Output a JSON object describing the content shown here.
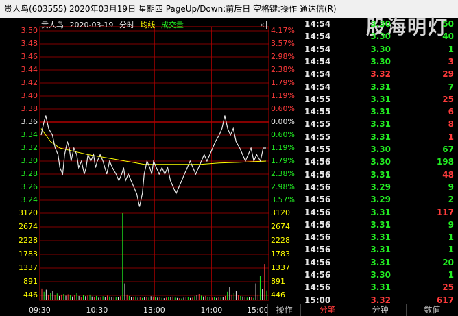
{
  "window": {
    "title": "贵人鸟(603555)  2020年03月19日 星期四  PageUp/Down:前后日  空格键:操作  通达信(R)",
    "watermark": "股海明灯"
  },
  "chart_header": {
    "name": "贵人鸟",
    "date": "2020-03-19",
    "mode": "分时",
    "legend_avg": "均线",
    "legend_vol": "成交量",
    "close_glyph": "×"
  },
  "colors": {
    "bg": "#000000",
    "grid": "#b00000",
    "price": "#e8e8e8",
    "avg": "#ffff00",
    "up": "#ff3b3b",
    "down": "#22ee22",
    "flat": "#e8e8e8"
  },
  "price_axis": {
    "left_labels": [
      "3.50",
      "3.48",
      "3.46",
      "3.44",
      "3.42",
      "3.40",
      "3.38",
      "3.36",
      "3.34",
      "3.32",
      "3.30",
      "3.28",
      "3.26",
      "3.24"
    ],
    "right_labels": [
      "4.17%",
      "3.57%",
      "2.98%",
      "2.38%",
      "1.79%",
      "1.19%",
      "0.60%",
      "0.00%",
      "0.60%",
      "1.19%",
      "1.79%",
      "2.38%",
      "2.98%",
      "3.57%"
    ]
  },
  "volume_axis": {
    "labels": [
      "3120",
      "2674",
      "2228",
      "1783",
      "1337",
      "891",
      "446"
    ]
  },
  "time_axis": {
    "labels": [
      "09:30",
      "10:30",
      "13:00",
      "14:00",
      "15:00"
    ],
    "corner": "操作"
  },
  "chart_data": {
    "type": "line",
    "prev_close": 3.36,
    "ylim": [
      3.23,
      3.51
    ],
    "x_range": [
      0,
      240
    ],
    "series": [
      {
        "points": [
          [
            0,
            3.34
          ],
          [
            3,
            3.36
          ],
          [
            5,
            3.37
          ],
          [
            8,
            3.35
          ],
          [
            12,
            3.34
          ],
          [
            15,
            3.32
          ],
          [
            18,
            3.31
          ],
          [
            20,
            3.29
          ],
          [
            23,
            3.28
          ],
          [
            25,
            3.31
          ],
          [
            28,
            3.33
          ],
          [
            30,
            3.32
          ],
          [
            32,
            3.3
          ],
          [
            35,
            3.32
          ],
          [
            38,
            3.31
          ],
          [
            40,
            3.29
          ],
          [
            43,
            3.3
          ],
          [
            46,
            3.28
          ],
          [
            48,
            3.29
          ],
          [
            50,
            3.31
          ],
          [
            53,
            3.3
          ],
          [
            56,
            3.31
          ],
          [
            58,
            3.29
          ],
          [
            60,
            3.3
          ],
          [
            63,
            3.31
          ],
          [
            66,
            3.3
          ],
          [
            68,
            3.29
          ],
          [
            70,
            3.28
          ],
          [
            73,
            3.3
          ],
          [
            76,
            3.29
          ],
          [
            80,
            3.28
          ],
          [
            83,
            3.27
          ],
          [
            86,
            3.28
          ],
          [
            88,
            3.29
          ],
          [
            90,
            3.27
          ],
          [
            93,
            3.28
          ],
          [
            96,
            3.27
          ],
          [
            99,
            3.26
          ],
          [
            102,
            3.25
          ],
          [
            105,
            3.23
          ],
          [
            108,
            3.25
          ],
          [
            110,
            3.28
          ],
          [
            113,
            3.3
          ],
          [
            116,
            3.29
          ],
          [
            118,
            3.28
          ],
          [
            120,
            3.3
          ],
          [
            123,
            3.29
          ],
          [
            126,
            3.28
          ],
          [
            129,
            3.29
          ],
          [
            132,
            3.28
          ],
          [
            135,
            3.29
          ],
          [
            138,
            3.27
          ],
          [
            141,
            3.26
          ],
          [
            144,
            3.25
          ],
          [
            147,
            3.26
          ],
          [
            150,
            3.27
          ],
          [
            153,
            3.28
          ],
          [
            156,
            3.29
          ],
          [
            159,
            3.3
          ],
          [
            162,
            3.29
          ],
          [
            165,
            3.28
          ],
          [
            168,
            3.29
          ],
          [
            171,
            3.3
          ],
          [
            174,
            3.31
          ],
          [
            177,
            3.3
          ],
          [
            180,
            3.31
          ],
          [
            183,
            3.32
          ],
          [
            186,
            3.33
          ],
          [
            190,
            3.34
          ],
          [
            193,
            3.35
          ],
          [
            196,
            3.37
          ],
          [
            199,
            3.35
          ],
          [
            202,
            3.34
          ],
          [
            205,
            3.35
          ],
          [
            208,
            3.33
          ],
          [
            212,
            3.32
          ],
          [
            215,
            3.31
          ],
          [
            218,
            3.3
          ],
          [
            221,
            3.31
          ],
          [
            224,
            3.32
          ],
          [
            227,
            3.3
          ],
          [
            230,
            3.31
          ],
          [
            234,
            3.3
          ],
          [
            237,
            3.32
          ],
          [
            240,
            3.32
          ]
        ]
      },
      {
        "points": [
          [
            0,
            3.35
          ],
          [
            5,
            3.34
          ],
          [
            10,
            3.33
          ],
          [
            20,
            3.32
          ],
          [
            35,
            3.315
          ],
          [
            50,
            3.31
          ],
          [
            70,
            3.305
          ],
          [
            90,
            3.3
          ],
          [
            110,
            3.295
          ],
          [
            130,
            3.295
          ],
          [
            150,
            3.295
          ],
          [
            170,
            3.295
          ],
          [
            190,
            3.297
          ],
          [
            210,
            3.298
          ],
          [
            240,
            3.3
          ]
        ]
      }
    ],
    "volume": [
      420,
      300,
      380,
      200,
      260,
      330,
      180,
      240,
      150,
      200,
      220,
      160,
      210,
      190,
      130,
      170,
      260,
      150,
      120,
      180,
      140,
      160,
      200,
      130,
      110,
      150,
      90,
      120,
      140,
      100,
      160,
      130,
      110,
      90,
      120,
      100,
      140,
      3120,
      600,
      200,
      150,
      120,
      100,
      130,
      90,
      110,
      80,
      100,
      120,
      90,
      140,
      130,
      110,
      90,
      100,
      80,
      70,
      90,
      110,
      100,
      130,
      90,
      80,
      70,
      60,
      90,
      120,
      100,
      80,
      90,
      140,
      180,
      220,
      160,
      130,
      150,
      120,
      100,
      90,
      110,
      80,
      100,
      90,
      120,
      150,
      300,
      480,
      200,
      260,
      320,
      180,
      150,
      130,
      110,
      90,
      100,
      120,
      80,
      600,
      200,
      880,
      400,
      1300,
      350
    ]
  },
  "ticks": [
    {
      "time": "14:54",
      "price": "3.30",
      "vol": "50",
      "dir": "down"
    },
    {
      "time": "14:54",
      "price": "3.30",
      "vol": "40",
      "dir": "down"
    },
    {
      "time": "14:54",
      "price": "3.30",
      "vol": "1",
      "dir": "down"
    },
    {
      "time": "14:54",
      "price": "3.30",
      "vol": "3",
      "dir": "up"
    },
    {
      "time": "14:54",
      "price": "3.32",
      "vol": "29",
      "dir": "up"
    },
    {
      "time": "14:54",
      "price": "3.31",
      "vol": "7",
      "dir": "down"
    },
    {
      "time": "14:55",
      "price": "3.31",
      "vol": "25",
      "dir": "up"
    },
    {
      "time": "14:55",
      "price": "3.31",
      "vol": "6",
      "dir": "up"
    },
    {
      "time": "14:55",
      "price": "3.31",
      "vol": "8",
      "dir": "up"
    },
    {
      "time": "14:55",
      "price": "3.31",
      "vol": "1",
      "dir": "up"
    },
    {
      "time": "14:55",
      "price": "3.30",
      "vol": "67",
      "dir": "down"
    },
    {
      "time": "14:56",
      "price": "3.30",
      "vol": "198",
      "dir": "down"
    },
    {
      "time": "14:56",
      "price": "3.31",
      "vol": "48",
      "dir": "up"
    },
    {
      "time": "14:56",
      "price": "3.29",
      "vol": "9",
      "dir": "down"
    },
    {
      "time": "14:56",
      "price": "3.29",
      "vol": "2",
      "dir": "down"
    },
    {
      "time": "14:56",
      "price": "3.31",
      "vol": "117",
      "dir": "up"
    },
    {
      "time": "14:56",
      "price": "3.31",
      "vol": "9",
      "dir": "down"
    },
    {
      "time": "14:56",
      "price": "3.31",
      "vol": "1",
      "dir": "down"
    },
    {
      "time": "14:56",
      "price": "3.31",
      "vol": "1",
      "dir": "down"
    },
    {
      "time": "14:56",
      "price": "3.31",
      "vol": "20",
      "dir": "down"
    },
    {
      "time": "14:56",
      "price": "3.30",
      "vol": "1",
      "dir": "down"
    },
    {
      "time": "14:56",
      "price": "3.31",
      "vol": "25",
      "dir": "up"
    },
    {
      "time": "15:00",
      "price": "3.32",
      "vol": "617",
      "dir": "up"
    }
  ],
  "tabs": [
    "分笔",
    "分钟",
    "数值"
  ]
}
